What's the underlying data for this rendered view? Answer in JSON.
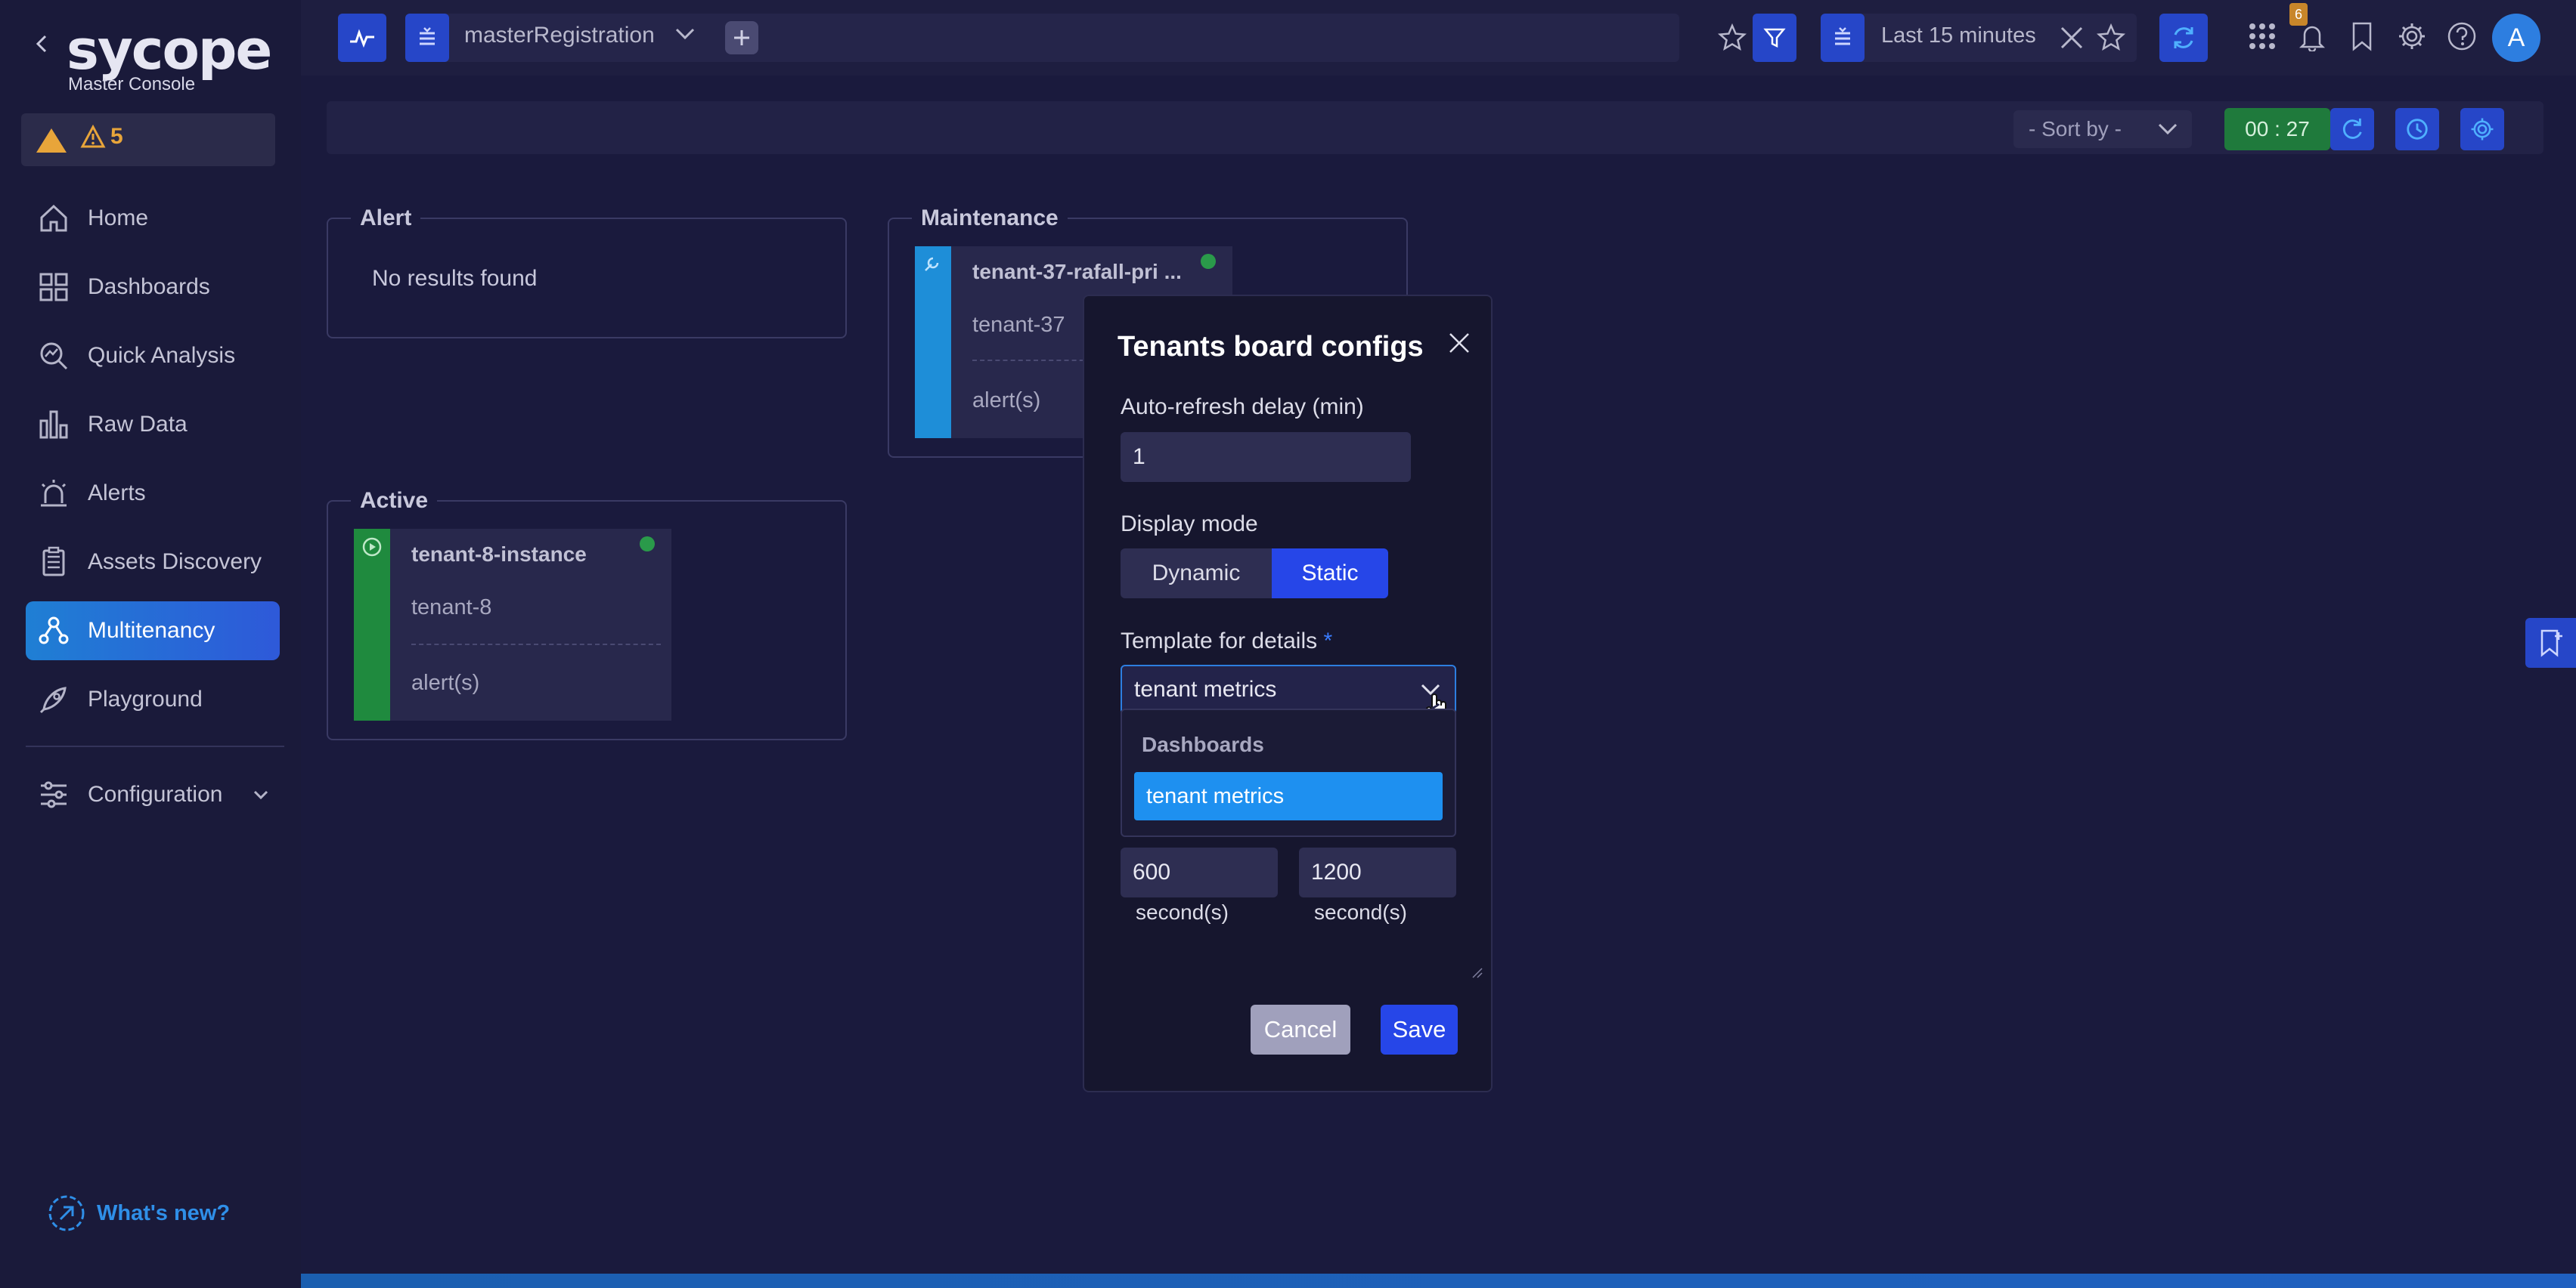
{
  "app": {
    "name": "sycope",
    "subtitle": "Master Console"
  },
  "sidebar": {
    "alerts_count": "5",
    "items": [
      {
        "label": "Home",
        "icon": "home-icon"
      },
      {
        "label": "Dashboards",
        "icon": "dashboards-icon"
      },
      {
        "label": "Quick Analysis",
        "icon": "quick-analysis-icon"
      },
      {
        "label": "Raw Data",
        "icon": "raw-data-icon"
      },
      {
        "label": "Alerts",
        "icon": "alerts-icon"
      },
      {
        "label": "Assets Discovery",
        "icon": "assets-discovery-icon"
      },
      {
        "label": "Multitenancy",
        "icon": "multitenancy-icon",
        "active": true
      },
      {
        "label": "Playground",
        "icon": "playground-icon"
      }
    ],
    "configuration": "Configuration",
    "whats_new": "What's new?"
  },
  "topbar": {
    "filter_name": "masterRegistration",
    "time_range": "Last 15 minutes",
    "notifications_badge": "6",
    "avatar": "A"
  },
  "toolbar": {
    "sort_by": "- Sort by -",
    "timer": "00 : 27"
  },
  "board": {
    "alert": {
      "title": "Alert",
      "empty": "No results found"
    },
    "maintenance": {
      "title": "Maintenance",
      "card": {
        "title": "tenant-37-rafall-pri ...",
        "tenant": "tenant-37",
        "alerts": "alert(s)"
      }
    },
    "active": {
      "title": "Active",
      "card": {
        "title": "tenant-8-instance",
        "tenant": "tenant-8",
        "alerts": "alert(s)"
      }
    }
  },
  "modal": {
    "title": "Tenants board configs",
    "refresh_label": "Auto-refresh delay (min)",
    "refresh_value": "1",
    "display_mode_label": "Display mode",
    "mode_dynamic": "Dynamic",
    "mode_static": "Static",
    "template_label": "Template for details",
    "required_mark": "*",
    "template_value": "tenant metrics",
    "dropdown_group": "Dashboards",
    "dropdown_option": "tenant metrics",
    "time1_value": "600",
    "time2_value": "1200",
    "unit": "second(s)",
    "cancel": "Cancel",
    "save": "Save"
  },
  "colors": {
    "background": "#1a1a3d",
    "accent": "#2646c8",
    "maintenance_stripe": "#1e8ed8",
    "active_stripe": "#1f8a3e",
    "warning": "#e8a53a"
  }
}
